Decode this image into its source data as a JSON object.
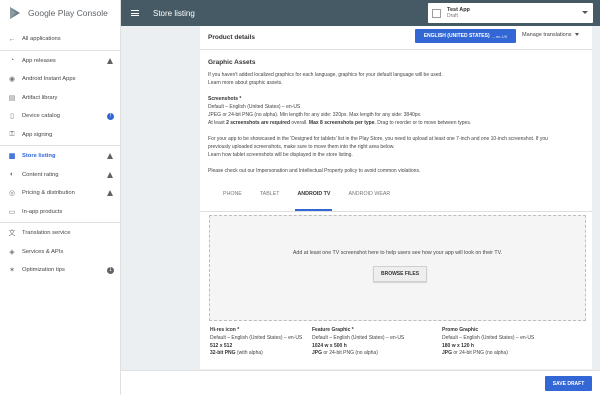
{
  "app": {
    "brand": "Google Play Console"
  },
  "sidebar": {
    "items": [
      {
        "label": "All applications",
        "icon": "arrow-left-icon"
      },
      {
        "label": "App releases",
        "icon": "rocket-icon",
        "status": "warning"
      },
      {
        "label": "Android Instant Apps",
        "icon": "instant-icon"
      },
      {
        "label": "Artifact library",
        "icon": "library-icon"
      },
      {
        "label": "Device catalog",
        "icon": "device-icon",
        "status": "info",
        "badge": "!"
      },
      {
        "label": "App signing",
        "icon": "key-icon"
      },
      {
        "label": "Store listing",
        "icon": "store-icon",
        "status": "warning",
        "active": true
      },
      {
        "label": "Content rating",
        "icon": "rating-icon",
        "status": "warning"
      },
      {
        "label": "Pricing & distribution",
        "icon": "price-icon",
        "status": "warning"
      },
      {
        "label": "In-app products",
        "icon": "cart-icon"
      },
      {
        "label": "Translation service",
        "icon": "translate-icon"
      },
      {
        "label": "Services & APIs",
        "icon": "api-icon"
      },
      {
        "label": "Optimization tips",
        "icon": "lightbulb-icon",
        "badge": "1"
      }
    ]
  },
  "topbar": {
    "title": "Store listing",
    "app_name": "Test App",
    "app_status": "Draft"
  },
  "card": {
    "title": "Product details",
    "language_button": "ENGLISH (UNITED STATES)",
    "language_code": "– en-US",
    "manage_translations": "Manage translations"
  },
  "graphics": {
    "title": "Graphic Assets",
    "intro_1": "If you haven't added localized graphics for each language, graphics for your default language will be used.",
    "intro_2": "Learn more about graphic assets.",
    "screenshots_label": "Screenshots *",
    "default_lang": "Default – English (United States) – en-US",
    "format_line": "JPEG or 24-bit PNG (no alpha). Min length for any side: 320px. Max length for any side: 3840px.",
    "required_pre": "At least ",
    "required_bold_1": "2 screenshots are required",
    "required_mid": " overall. ",
    "required_bold_2": "Max 8 screenshots per type",
    "required_post": ". Drag to reorder or to move between types.",
    "tablets_1": "For your app to be showcased in the 'Designed for tablets' list in the Play Store, you need to upload at least one 7-inch and one 10-inch screenshot. If you",
    "tablets_2": "previously uploaded screenshots, make sure to move them into the right area below.",
    "tablets_3": "Learn how tablet screenshots will be displayed in the store listing.",
    "policy": "Please check out our Impersonation and Intellectual Property policy to avoid common violations."
  },
  "tabs": [
    {
      "label": "PHONE",
      "active": false
    },
    {
      "label": "TABLET",
      "active": false
    },
    {
      "label": "ANDROID TV",
      "active": true
    },
    {
      "label": "ANDROID WEAR",
      "active": false
    }
  ],
  "dropzone": {
    "text": "Add at least one TV screenshot here to help users see how your app will look on their TV.",
    "button": "BROWSE FILES"
  },
  "assets": [
    {
      "title": "Hi-res icon *",
      "lang": "Default – English (United States) – en-US",
      "size": "512 x 512",
      "format_bold": "32-bit PNG",
      "format_rest": " (with alpha)"
    },
    {
      "title": "Feature Graphic *",
      "lang": "Default – English (United States) – en-US",
      "size": "1024 w x 500 h",
      "format_bold": "JPG",
      "format_rest": " or 24-bit PNG (no alpha)"
    },
    {
      "title": "Promo Graphic",
      "lang": "Default – English (United States) – en-US",
      "size": "180 w x 120 h",
      "format_bold": "JPG",
      "format_rest": " or 24-bit PNG (no alpha)"
    }
  ],
  "footer": {
    "save": "SAVE DRAFT"
  },
  "colors": {
    "accent": "#3367d6",
    "topbar": "#455a64",
    "background": "#eceff1"
  }
}
